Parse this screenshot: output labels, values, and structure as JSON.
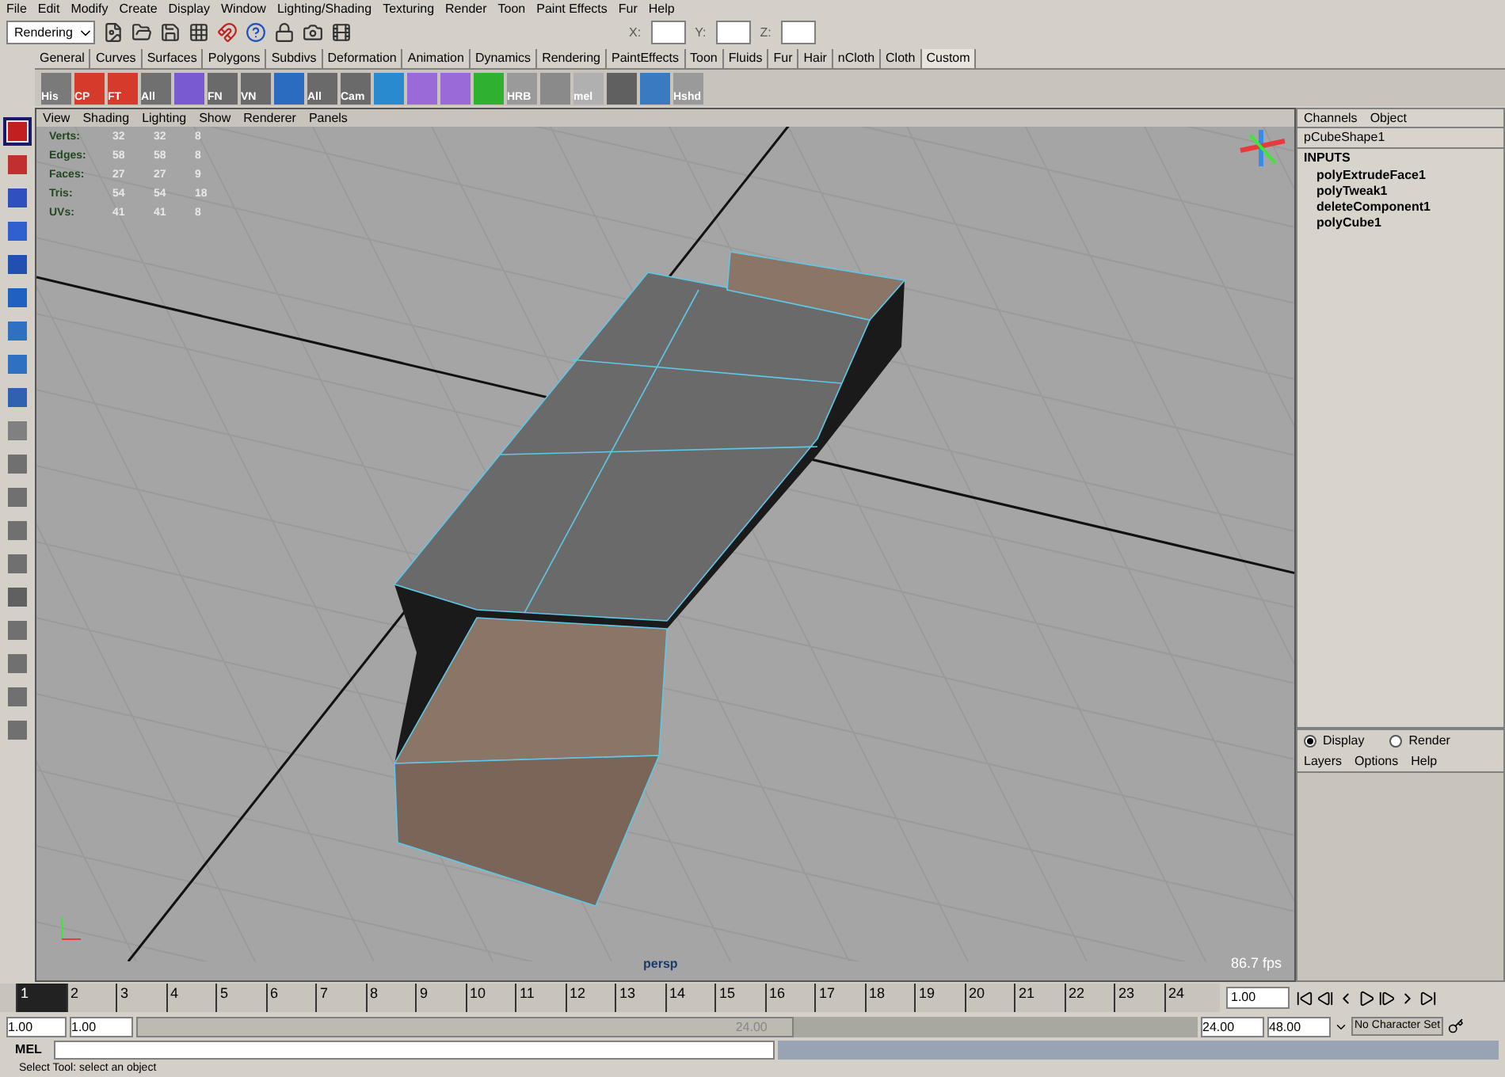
{
  "menu_bar": [
    "File",
    "Edit",
    "Modify",
    "Create",
    "Display",
    "Window",
    "Lighting/Shading",
    "Texturing",
    "Render",
    "Toon",
    "Paint Effects",
    "Fur",
    "Help"
  ],
  "status_line": {
    "mode": "Rendering",
    "fields": [
      {
        "label": "X:"
      },
      {
        "label": "Y:"
      },
      {
        "label": "Z:"
      }
    ]
  },
  "shelf_tabs": [
    {
      "label": "General",
      "selected": false
    },
    {
      "label": "Curves",
      "selected": false
    },
    {
      "label": "Surfaces",
      "selected": false
    },
    {
      "label": "Polygons",
      "selected": false
    },
    {
      "label": "Subdivs",
      "selected": false
    },
    {
      "label": "Deformation",
      "selected": false
    },
    {
      "label": "Animation",
      "selected": false
    },
    {
      "label": "Dynamics",
      "selected": false
    },
    {
      "label": "Rendering",
      "selected": false
    },
    {
      "label": "PaintEffects",
      "selected": false
    },
    {
      "label": "Toon",
      "selected": false
    },
    {
      "label": "Fluids",
      "selected": false
    },
    {
      "label": "Fur",
      "selected": false
    },
    {
      "label": "Hair",
      "selected": false
    },
    {
      "label": "nCloth",
      "selected": false
    },
    {
      "label": "Cloth",
      "selected": false
    },
    {
      "label": "Custom",
      "selected": true
    }
  ],
  "shelf_items": [
    {
      "kind": "labeled",
      "label": "His"
    },
    {
      "kind": "labeled",
      "label": "CP"
    },
    {
      "kind": "labeled",
      "label": "FT"
    },
    {
      "kind": "labeled",
      "label": "All"
    },
    {
      "kind": "icon"
    },
    {
      "kind": "labeled",
      "label": "FN"
    },
    {
      "kind": "labeled",
      "label": "VN"
    },
    {
      "kind": "icon"
    },
    {
      "kind": "labeled",
      "label": "All"
    },
    {
      "kind": "labeled",
      "label": "Cam"
    },
    {
      "kind": "icon"
    },
    {
      "kind": "icon"
    },
    {
      "kind": "icon"
    },
    {
      "kind": "icon"
    },
    {
      "kind": "labeled",
      "label": "HRB"
    },
    {
      "kind": "icon"
    },
    {
      "kind": "labeled",
      "label": "mel"
    },
    {
      "kind": "icon"
    },
    {
      "kind": "icon"
    },
    {
      "kind": "labeled",
      "label": "Hshd"
    }
  ],
  "toolbox": [
    {
      "selected": true
    },
    {
      "selected": false
    },
    {
      "selected": false
    },
    {
      "selected": false
    },
    {
      "selected": false
    },
    {
      "selected": false
    },
    {
      "selected": false
    },
    {
      "selected": false
    },
    {
      "selected": false
    },
    {
      "selected": false
    },
    {
      "selected": false
    },
    {
      "selected": false
    },
    {
      "selected": false
    },
    {
      "selected": false
    },
    {
      "selected": false
    },
    {
      "selected": false
    },
    {
      "selected": false
    },
    {
      "selected": false
    },
    {
      "selected": false
    }
  ],
  "viewport": {
    "menu": [
      "View",
      "Shading",
      "Lighting",
      "Show",
      "Renderer",
      "Panels"
    ],
    "stats": [
      {
        "name": "Verts:",
        "values": [
          "32",
          "32",
          "8"
        ]
      },
      {
        "name": "Edges:",
        "values": [
          "58",
          "58",
          "8"
        ]
      },
      {
        "name": "Faces:",
        "values": [
          "27",
          "27",
          "9"
        ]
      },
      {
        "name": "Tris:",
        "values": [
          "54",
          "54",
          "18"
        ]
      },
      {
        "name": "UVs:",
        "values": [
          "41",
          "41",
          "8"
        ]
      }
    ],
    "camera": "persp",
    "fps": "86.7 fps"
  },
  "channel_box": {
    "menu": [
      "Channels",
      "Object"
    ],
    "shape": "pCubeShape1",
    "inputs_title": "INPUTS",
    "inputs": [
      "polyExtrudeFace1",
      "polyTweak1",
      "deleteComponent1",
      "polyCube1"
    ]
  },
  "layer_editor": {
    "modes": [
      {
        "label": "Display",
        "selected": true
      },
      {
        "label": "Render",
        "selected": false
      }
    ],
    "menu": [
      "Layers",
      "Options",
      "Help"
    ]
  },
  "timeline": {
    "frames": [
      {
        "label": "1",
        "selected": true
      },
      {
        "label": "2",
        "selected": false
      },
      {
        "label": "3",
        "selected": false
      },
      {
        "label": "4",
        "selected": false
      },
      {
        "label": "5",
        "selected": false
      },
      {
        "label": "6",
        "selected": false
      },
      {
        "label": "7",
        "selected": false
      },
      {
        "label": "8",
        "selected": false
      },
      {
        "label": "9",
        "selected": false
      },
      {
        "label": "10",
        "selected": false
      },
      {
        "label": "11",
        "selected": false
      },
      {
        "label": "12",
        "selected": false
      },
      {
        "label": "13",
        "selected": false
      },
      {
        "label": "14",
        "selected": false
      },
      {
        "label": "15",
        "selected": false
      },
      {
        "label": "16",
        "selected": false
      },
      {
        "label": "17",
        "selected": false
      },
      {
        "label": "18",
        "selected": false
      },
      {
        "label": "19",
        "selected": false
      },
      {
        "label": "20",
        "selected": false
      },
      {
        "label": "21",
        "selected": false
      },
      {
        "label": "22",
        "selected": false
      },
      {
        "label": "23",
        "selected": false
      },
      {
        "label": "24",
        "selected": false
      }
    ],
    "current_time": "1.00"
  },
  "range_slider": {
    "start": "1.00",
    "playback_start": "1.00",
    "slider_label": "24.00",
    "level": 0.62,
    "playback_end": "24.00",
    "end": "48.00",
    "character_set": "No Character Set"
  },
  "command_line": {
    "label": "MEL"
  },
  "help_line": "Select Tool: select an object"
}
